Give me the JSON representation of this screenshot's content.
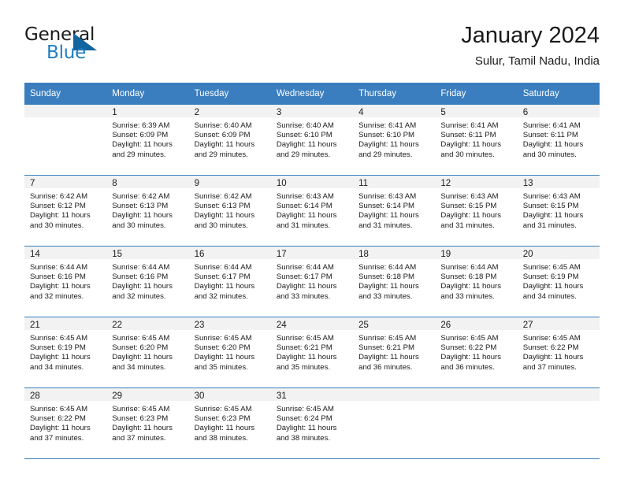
{
  "brand": {
    "word1": "General",
    "word2": "Blue",
    "triangle_color": "#12659f",
    "blue_color": "#1f7fc4"
  },
  "header": {
    "title": "January 2024",
    "subtitle": "Sulur, Tamil Nadu, India"
  },
  "theme": {
    "header_bg": "#3a7ebf",
    "daynum_bg": "#f2f2f2",
    "grid_line": "#3a7ebf",
    "text": "#1a1a1a"
  },
  "weekday_headers": [
    "Sunday",
    "Monday",
    "Tuesday",
    "Wednesday",
    "Thursday",
    "Friday",
    "Saturday"
  ],
  "weeks": [
    [
      {
        "day": "",
        "sunrise": "",
        "sunset": "",
        "daylight1": "",
        "daylight2": ""
      },
      {
        "day": "1",
        "sunrise": "Sunrise: 6:39 AM",
        "sunset": "Sunset: 6:09 PM",
        "daylight1": "Daylight: 11 hours",
        "daylight2": "and 29 minutes."
      },
      {
        "day": "2",
        "sunrise": "Sunrise: 6:40 AM",
        "sunset": "Sunset: 6:09 PM",
        "daylight1": "Daylight: 11 hours",
        "daylight2": "and 29 minutes."
      },
      {
        "day": "3",
        "sunrise": "Sunrise: 6:40 AM",
        "sunset": "Sunset: 6:10 PM",
        "daylight1": "Daylight: 11 hours",
        "daylight2": "and 29 minutes."
      },
      {
        "day": "4",
        "sunrise": "Sunrise: 6:41 AM",
        "sunset": "Sunset: 6:10 PM",
        "daylight1": "Daylight: 11 hours",
        "daylight2": "and 29 minutes."
      },
      {
        "day": "5",
        "sunrise": "Sunrise: 6:41 AM",
        "sunset": "Sunset: 6:11 PM",
        "daylight1": "Daylight: 11 hours",
        "daylight2": "and 30 minutes."
      },
      {
        "day": "6",
        "sunrise": "Sunrise: 6:41 AM",
        "sunset": "Sunset: 6:11 PM",
        "daylight1": "Daylight: 11 hours",
        "daylight2": "and 30 minutes."
      }
    ],
    [
      {
        "day": "7",
        "sunrise": "Sunrise: 6:42 AM",
        "sunset": "Sunset: 6:12 PM",
        "daylight1": "Daylight: 11 hours",
        "daylight2": "and 30 minutes."
      },
      {
        "day": "8",
        "sunrise": "Sunrise: 6:42 AM",
        "sunset": "Sunset: 6:13 PM",
        "daylight1": "Daylight: 11 hours",
        "daylight2": "and 30 minutes."
      },
      {
        "day": "9",
        "sunrise": "Sunrise: 6:42 AM",
        "sunset": "Sunset: 6:13 PM",
        "daylight1": "Daylight: 11 hours",
        "daylight2": "and 30 minutes."
      },
      {
        "day": "10",
        "sunrise": "Sunrise: 6:43 AM",
        "sunset": "Sunset: 6:14 PM",
        "daylight1": "Daylight: 11 hours",
        "daylight2": "and 31 minutes."
      },
      {
        "day": "11",
        "sunrise": "Sunrise: 6:43 AM",
        "sunset": "Sunset: 6:14 PM",
        "daylight1": "Daylight: 11 hours",
        "daylight2": "and 31 minutes."
      },
      {
        "day": "12",
        "sunrise": "Sunrise: 6:43 AM",
        "sunset": "Sunset: 6:15 PM",
        "daylight1": "Daylight: 11 hours",
        "daylight2": "and 31 minutes."
      },
      {
        "day": "13",
        "sunrise": "Sunrise: 6:43 AM",
        "sunset": "Sunset: 6:15 PM",
        "daylight1": "Daylight: 11 hours",
        "daylight2": "and 31 minutes."
      }
    ],
    [
      {
        "day": "14",
        "sunrise": "Sunrise: 6:44 AM",
        "sunset": "Sunset: 6:16 PM",
        "daylight1": "Daylight: 11 hours",
        "daylight2": "and 32 minutes."
      },
      {
        "day": "15",
        "sunrise": "Sunrise: 6:44 AM",
        "sunset": "Sunset: 6:16 PM",
        "daylight1": "Daylight: 11 hours",
        "daylight2": "and 32 minutes."
      },
      {
        "day": "16",
        "sunrise": "Sunrise: 6:44 AM",
        "sunset": "Sunset: 6:17 PM",
        "daylight1": "Daylight: 11 hours",
        "daylight2": "and 32 minutes."
      },
      {
        "day": "17",
        "sunrise": "Sunrise: 6:44 AM",
        "sunset": "Sunset: 6:17 PM",
        "daylight1": "Daylight: 11 hours",
        "daylight2": "and 33 minutes."
      },
      {
        "day": "18",
        "sunrise": "Sunrise: 6:44 AM",
        "sunset": "Sunset: 6:18 PM",
        "daylight1": "Daylight: 11 hours",
        "daylight2": "and 33 minutes."
      },
      {
        "day": "19",
        "sunrise": "Sunrise: 6:44 AM",
        "sunset": "Sunset: 6:18 PM",
        "daylight1": "Daylight: 11 hours",
        "daylight2": "and 33 minutes."
      },
      {
        "day": "20",
        "sunrise": "Sunrise: 6:45 AM",
        "sunset": "Sunset: 6:19 PM",
        "daylight1": "Daylight: 11 hours",
        "daylight2": "and 34 minutes."
      }
    ],
    [
      {
        "day": "21",
        "sunrise": "Sunrise: 6:45 AM",
        "sunset": "Sunset: 6:19 PM",
        "daylight1": "Daylight: 11 hours",
        "daylight2": "and 34 minutes."
      },
      {
        "day": "22",
        "sunrise": "Sunrise: 6:45 AM",
        "sunset": "Sunset: 6:20 PM",
        "daylight1": "Daylight: 11 hours",
        "daylight2": "and 34 minutes."
      },
      {
        "day": "23",
        "sunrise": "Sunrise: 6:45 AM",
        "sunset": "Sunset: 6:20 PM",
        "daylight1": "Daylight: 11 hours",
        "daylight2": "and 35 minutes."
      },
      {
        "day": "24",
        "sunrise": "Sunrise: 6:45 AM",
        "sunset": "Sunset: 6:21 PM",
        "daylight1": "Daylight: 11 hours",
        "daylight2": "and 35 minutes."
      },
      {
        "day": "25",
        "sunrise": "Sunrise: 6:45 AM",
        "sunset": "Sunset: 6:21 PM",
        "daylight1": "Daylight: 11 hours",
        "daylight2": "and 36 minutes."
      },
      {
        "day": "26",
        "sunrise": "Sunrise: 6:45 AM",
        "sunset": "Sunset: 6:22 PM",
        "daylight1": "Daylight: 11 hours",
        "daylight2": "and 36 minutes."
      },
      {
        "day": "27",
        "sunrise": "Sunrise: 6:45 AM",
        "sunset": "Sunset: 6:22 PM",
        "daylight1": "Daylight: 11 hours",
        "daylight2": "and 37 minutes."
      }
    ],
    [
      {
        "day": "28",
        "sunrise": "Sunrise: 6:45 AM",
        "sunset": "Sunset: 6:22 PM",
        "daylight1": "Daylight: 11 hours",
        "daylight2": "and 37 minutes."
      },
      {
        "day": "29",
        "sunrise": "Sunrise: 6:45 AM",
        "sunset": "Sunset: 6:23 PM",
        "daylight1": "Daylight: 11 hours",
        "daylight2": "and 37 minutes."
      },
      {
        "day": "30",
        "sunrise": "Sunrise: 6:45 AM",
        "sunset": "Sunset: 6:23 PM",
        "daylight1": "Daylight: 11 hours",
        "daylight2": "and 38 minutes."
      },
      {
        "day": "31",
        "sunrise": "Sunrise: 6:45 AM",
        "sunset": "Sunset: 6:24 PM",
        "daylight1": "Daylight: 11 hours",
        "daylight2": "and 38 minutes."
      },
      {
        "day": "",
        "sunrise": "",
        "sunset": "",
        "daylight1": "",
        "daylight2": ""
      },
      {
        "day": "",
        "sunrise": "",
        "sunset": "",
        "daylight1": "",
        "daylight2": ""
      },
      {
        "day": "",
        "sunrise": "",
        "sunset": "",
        "daylight1": "",
        "daylight2": ""
      }
    ]
  ]
}
